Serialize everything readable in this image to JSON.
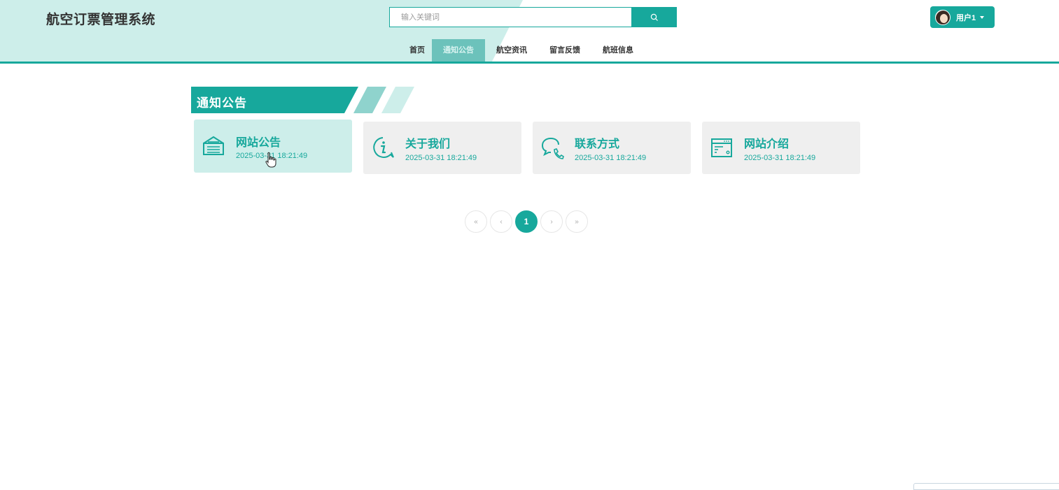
{
  "header": {
    "site_title": "航空订票管理系统",
    "search_placeholder": "输入关键词",
    "user_label": "用户1",
    "nav": [
      {
        "label": "首页",
        "active": false
      },
      {
        "label": "通知公告",
        "active": true
      },
      {
        "label": "航空资讯",
        "active": false
      },
      {
        "label": "留言反馈",
        "active": false
      },
      {
        "label": "航班信息",
        "active": false
      }
    ]
  },
  "section": {
    "title": "通知公告"
  },
  "cards": [
    {
      "title": "网站公告",
      "date": "2025-03-31 18:21:49",
      "icon": "notice-icon",
      "active": true
    },
    {
      "title": "关于我们",
      "date": "2025-03-31 18:21:49",
      "icon": "info-icon",
      "active": false
    },
    {
      "title": "联系方式",
      "date": "2025-03-31 18:21:49",
      "icon": "chat-phone-icon",
      "active": false
    },
    {
      "title": "网站介绍",
      "date": "2025-03-31 18:21:49",
      "icon": "browser-window-icon",
      "active": false
    }
  ],
  "pagination": {
    "first": "«",
    "prev": "‹",
    "current": "1",
    "next": "›",
    "last": "»"
  },
  "colors": {
    "accent": "#17a89c",
    "header_bg": "#cdeeea",
    "active_nav": "#6cc2bb"
  }
}
